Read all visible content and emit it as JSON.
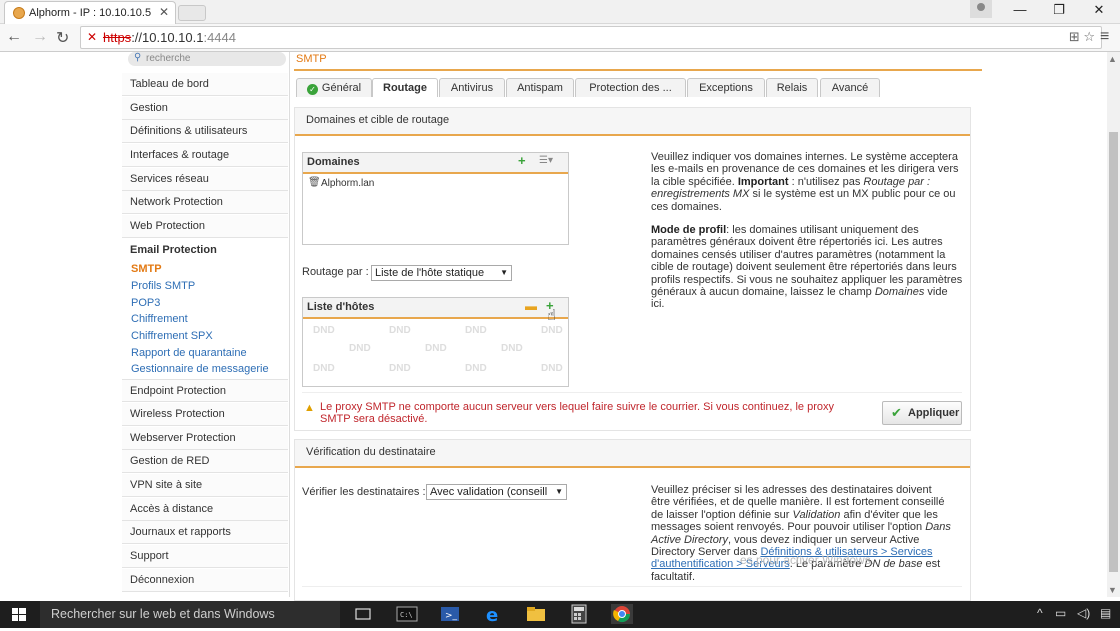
{
  "browser": {
    "tab_title": "Alphorm - IP : 10.10.10.5",
    "tab_close": "✕",
    "url_scheme": "https",
    "url_host": "://10.10.10.1",
    "url_port": ":4444",
    "window_controls": {
      "minimize": "—",
      "restore": "❐",
      "close": "✕"
    }
  },
  "sidebar": {
    "search_placeholder": "recherche",
    "items": [
      "Tableau de bord",
      "Gestion",
      "Définitions & utilisateurs",
      "Interfaces & routage",
      "Services réseau",
      "Network Protection",
      "Web Protection",
      "Email Protection"
    ],
    "sub_items": [
      "SMTP",
      "Profils SMTP",
      "POP3",
      "Chiffrement",
      "Chiffrement SPX",
      "Rapport de quarantaine",
      "Gestionnaire de messagerie"
    ],
    "items_after": [
      "Endpoint Protection",
      "Wireless Protection",
      "Webserver Protection",
      "Gestion de RED",
      "VPN site à site",
      "Accès à distance",
      "Journaux et rapports",
      "Support",
      "Déconnexion"
    ]
  },
  "breadcrumb": "SMTP",
  "tabs": [
    "Général",
    "Routage",
    "Antivirus",
    "Antispam",
    "Protection des ...",
    "Exceptions",
    "Relais",
    "Avancé"
  ],
  "active_tab": "Routage",
  "routing_section": {
    "title": "Domaines et cible de routage",
    "domains_box_title": "Domaines",
    "domains": [
      "Alphorm.lan"
    ],
    "routage_label": "Routage par :",
    "routage_value": "Liste de l'hôte statique",
    "hosts_box_title": "Liste d'hôtes",
    "dnd_label": "DND",
    "help_p1_a": "Veuillez indiquer vos domaines internes. Le système acceptera les e-mails en provenance de ces domaines et les dirigera vers la cible spécifiée. ",
    "help_p1_b_bold": "Important",
    "help_p1_c": " : n'utilisez pas ",
    "help_p1_d_italic": "Routage par : enregistrements MX",
    "help_p1_e": " si le système est un MX public pour ce ou ces domaines.",
    "help_p2_bold": "Mode de profil",
    "help_p2_a": ": les domaines utilisant uniquement des paramètres généraux doivent être répertoriés ici. Les autres domaines censés utiliser d'autres paramètres (notamment la cible de routage) doivent seulement être répertoriés dans leurs profils respectifs. Si vous ne souhaitez appliquer les paramètres généraux à aucun domaine, laissez le champ ",
    "help_p2_italic": "Domaines",
    "help_p2_b": " vide ici.",
    "warning": "Le proxy SMTP ne comporte aucun serveur vers lequel faire suivre le courrier. Si vous continuez, le proxy SMTP sera désactivé.",
    "apply_label": "Appliquer"
  },
  "recipient_section": {
    "title": "Vérification du destinataire",
    "verify_label": "Vérifier les destinataires :",
    "verify_value": "Avec validation (conseill",
    "help_a": "Veuillez préciser si les adresses des destinataires doivent être vérifiées, et de quelle manière. Il est fortement conseillé de laisser l'option définie sur ",
    "help_italic1": "Validation",
    "help_b": " afin d'éviter que les messages soient renvoyés. Pour pouvoir utiliser l'option ",
    "help_italic2": "Dans Active Directory",
    "help_c": ", vous devez indiquer un serveur Active Directory Server dans ",
    "help_link": "Définitions & utilisateurs > Services d'authentification > Serveurs",
    "help_d": ". Le paramètre ",
    "help_italic3": "DN de base",
    "help_e": " est facultatif."
  },
  "watermark": "es pour activer Windows.",
  "taskbar": {
    "search_text": "Rechercher sur le web et dans Windows"
  },
  "colors": {
    "accent_orange": "#e37a14",
    "link_blue": "#2e6eb5",
    "warning_red": "#c0262c",
    "ok_green": "#3aa33a"
  }
}
